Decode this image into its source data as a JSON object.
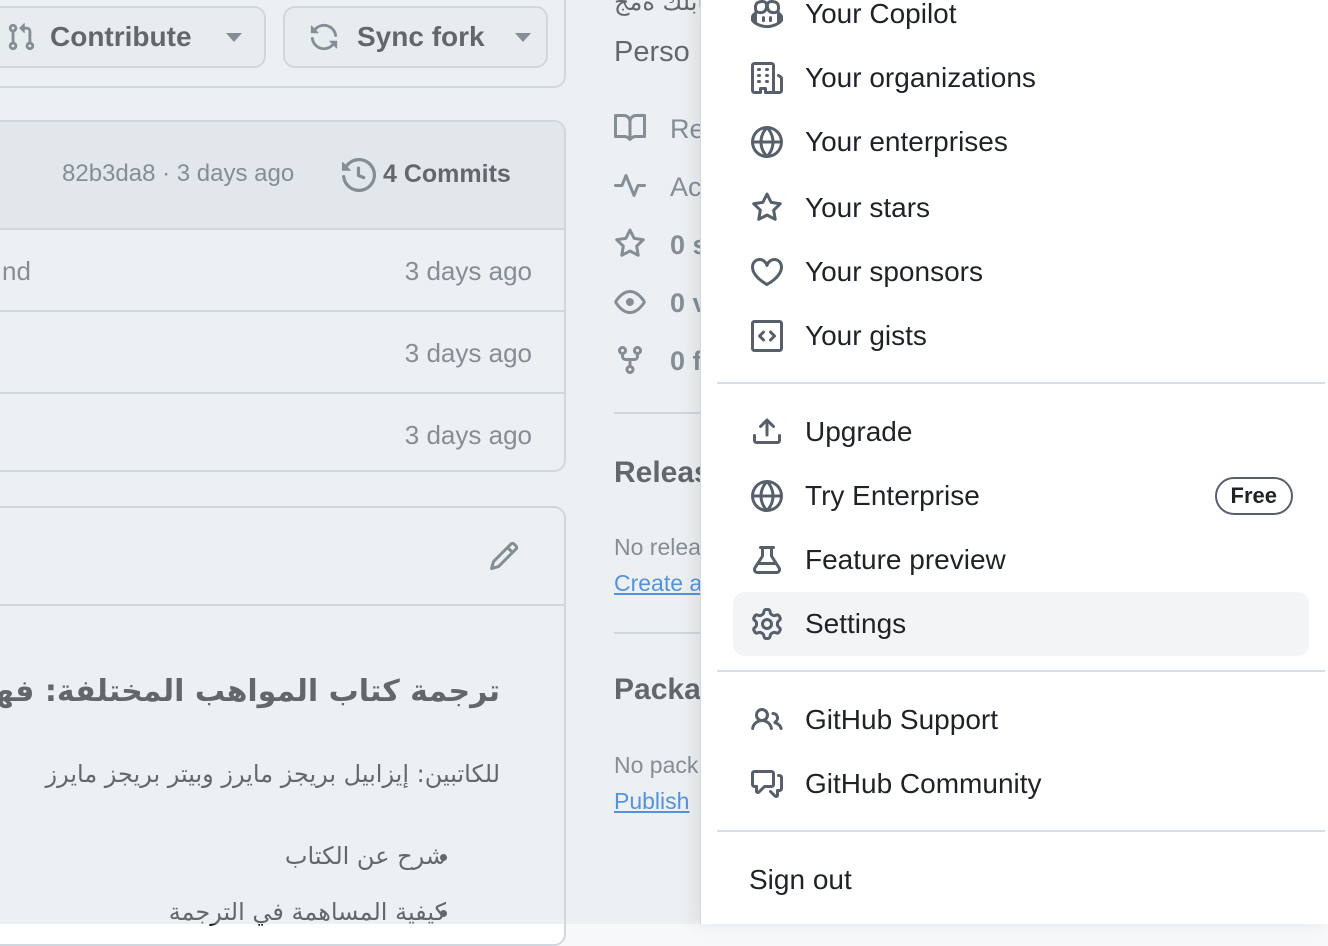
{
  "repo_header": {
    "contribute_label": "Contribute",
    "sync_fork_label": "Sync fork",
    "about_title_partial": "تابلك ةمج",
    "persona_partial": "Perso"
  },
  "commits": {
    "latest_hash_time": "82b3da8 · 3 days ago",
    "commits_label": "4 Commits",
    "rows": [
      {
        "name_partial": "nd",
        "time": "3 days ago"
      },
      {
        "name_partial": "",
        "time": "3 days ago"
      },
      {
        "name_partial": "",
        "time": "3 days ago"
      }
    ]
  },
  "readme": {
    "heading": "ترجمة كتاب المواهب المختلفة: فهم أنما",
    "authors": "للكاتبين: إيزابيل بريجز مايرز وبيتر بريجز مايرز",
    "bullets": [
      "شرح عن الكتاب",
      "كيفية المساهمة في الترجمة"
    ]
  },
  "sidebar": {
    "readme_partial": "Re",
    "activity_partial": "Ac",
    "stars_partial": "0 s",
    "watchers_partial": "0 v",
    "forks_partial": "0 f",
    "releases_title_partial": "Releas",
    "no_releases_partial": "No relea",
    "create_release_partial": "Create a",
    "packages_title_partial": "Packa",
    "no_packages_partial": "No pack",
    "publish_partial": "Publish"
  },
  "menu": {
    "items_top": [
      {
        "label": "Your Copilot",
        "icon": "copilot-icon"
      },
      {
        "label": "Your organizations",
        "icon": "organization-icon"
      },
      {
        "label": "Your enterprises",
        "icon": "globe-icon"
      },
      {
        "label": "Your stars",
        "icon": "star-icon"
      },
      {
        "label": "Your sponsors",
        "icon": "heart-icon"
      },
      {
        "label": "Your gists",
        "icon": "code-square-icon"
      }
    ],
    "items_mid": [
      {
        "label": "Upgrade",
        "icon": "upload-icon"
      },
      {
        "label": "Try Enterprise",
        "icon": "globe-icon",
        "badge": "Free"
      },
      {
        "label": "Feature preview",
        "icon": "beaker-icon"
      },
      {
        "label": "Settings",
        "icon": "gear-icon",
        "active": true
      }
    ],
    "items_support": [
      {
        "label": "GitHub Support",
        "icon": "people-icon"
      },
      {
        "label": "GitHub Community",
        "icon": "comment-discussion-icon"
      }
    ],
    "sign_out": "Sign out"
  },
  "colors": {
    "link": "#0969da",
    "muted": "#57606a",
    "border": "#d0d7de",
    "active_bg": "#f3f4f6"
  }
}
